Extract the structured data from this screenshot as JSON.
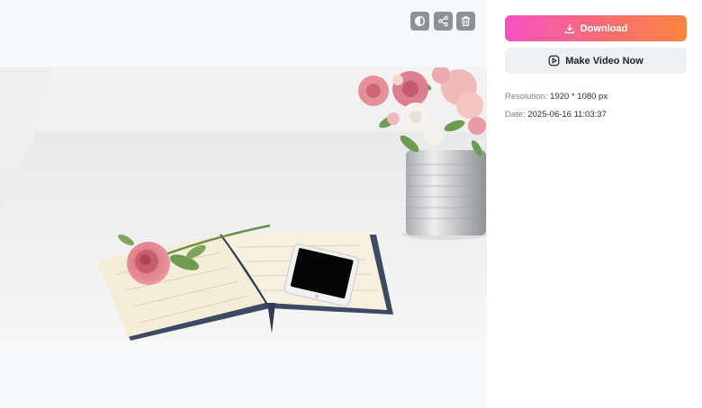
{
  "toolbar": {
    "icons": [
      "compare-icon",
      "share-icon",
      "trash-icon"
    ]
  },
  "panel": {
    "download_label": "Download",
    "make_video_label": "Make Video Now",
    "resolution_label": "Resolution:",
    "resolution_value": "1920 * 1080 px",
    "date_label": "Date:",
    "date_value": "2025-06-16 11:03:37"
  },
  "colors": {
    "download_gradient_start": "#f553c3",
    "download_gradient_end": "#fb8540",
    "secondary_button_bg": "#eff0f4",
    "toolbar_button_bg": "#8e9297",
    "preview_bg": "#f7f8fa"
  }
}
